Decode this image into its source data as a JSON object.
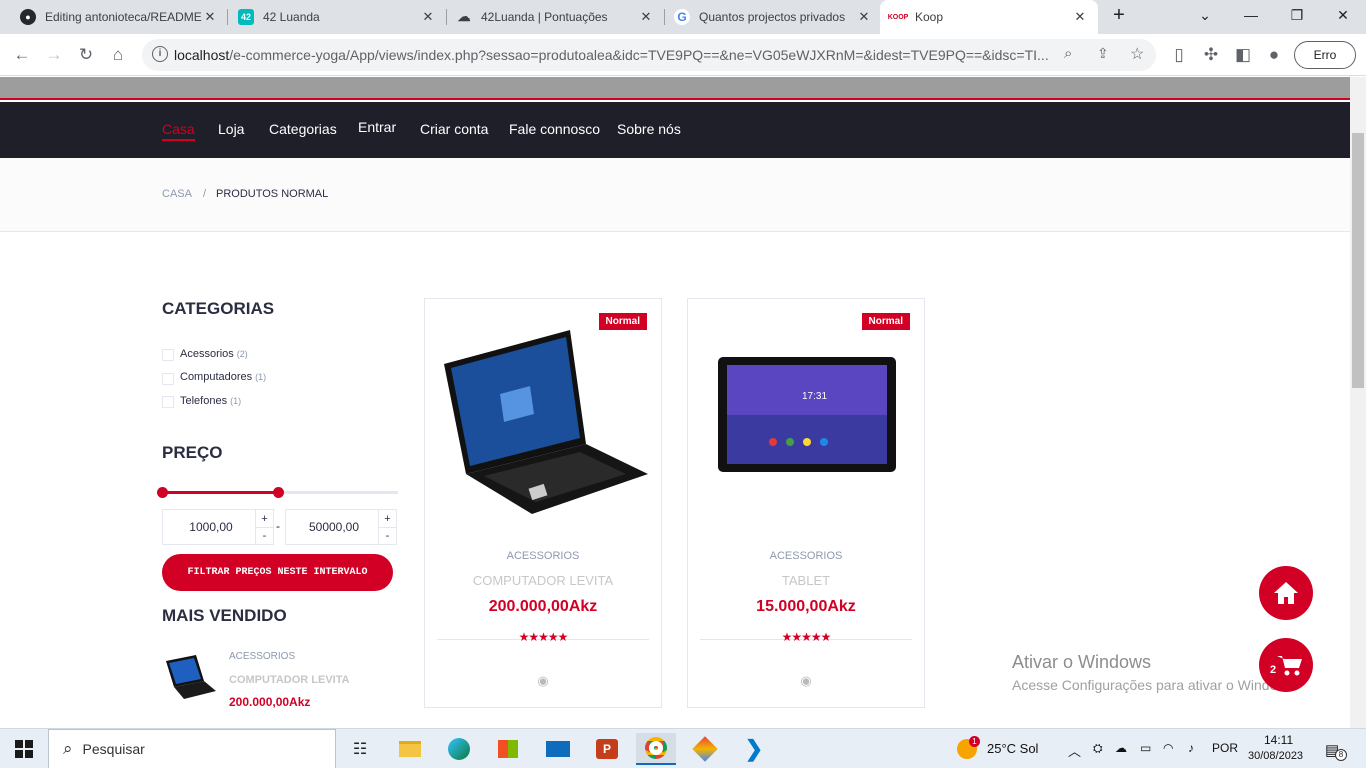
{
  "browser": {
    "tabs": [
      {
        "title": "Editing antonioteca/README",
        "icon": "github-icon"
      },
      {
        "title": "42 Luanda",
        "icon": "42-icon"
      },
      {
        "title": "42Luanda | Pontuações",
        "icon": "42luanda-icon"
      },
      {
        "title": "Quantos projectos privados",
        "icon": "google-icon"
      },
      {
        "title": "Koop",
        "icon": "koop-icon"
      }
    ],
    "url_host": "localhost",
    "url_path": "/e-commerce-yoga/App/views/index.php?sessao=produtoalea&idc=TVE9PQ==&ne=VG05eWJXRnM=&idest=TVE9PQ==&idsc=TI...",
    "error_label": "Erro"
  },
  "nav": {
    "items": [
      "Casa",
      "Loja",
      "Categorias",
      "Entrar",
      "Criar conta",
      "Fale connosco",
      "Sobre nós"
    ]
  },
  "breadcrumb": {
    "home": "Casa",
    "separator": "/",
    "current": "Produtos Normal"
  },
  "sidebar": {
    "categories_title": "Categorias",
    "categories": [
      {
        "label": "Acessorios",
        "count": "(2)"
      },
      {
        "label": "Computadores",
        "count": "(1)"
      },
      {
        "label": "Telefones",
        "count": "(1)"
      }
    ],
    "price_title": "Preço",
    "price_min": "1000,00",
    "price_max": "50000,00",
    "price_dash": "-",
    "plus": "+",
    "minus": "-",
    "filter_button": "FILTRAR PREÇOS NESTE INTERVALO",
    "bestsellers_title": "Mais vendido",
    "bestseller": {
      "category": "ACESSORIOS",
      "name": "COMPUTADOR LEVITA",
      "price": "200.000,00Akz"
    }
  },
  "products": [
    {
      "badge": "Normal",
      "category": "ACESSORIOS",
      "name": "COMPUTADOR LEVITA",
      "price": "200.000,00Akz",
      "rating": 5,
      "stars": "★★★★★"
    },
    {
      "badge": "Normal",
      "category": "ACESSORIOS",
      "name": "TABLET",
      "price": "15.000,00Akz",
      "rating": 5,
      "stars": "★★★★★"
    }
  ],
  "cart_count": "2",
  "tablet_time": "17:31",
  "watermark": {
    "line1": "Ativar o Windows",
    "line2": "Acesse Configurações para ativar o Windows."
  },
  "taskbar": {
    "search_placeholder": "Pesquisar",
    "weather": "25°C  Sol",
    "language": "POR",
    "time": "14:11",
    "date": "30/08/2023",
    "weather_badge": "1",
    "notification_count": "8"
  },
  "colors": {
    "accent": "#d10024",
    "nav_bg": "#1e1f29"
  }
}
